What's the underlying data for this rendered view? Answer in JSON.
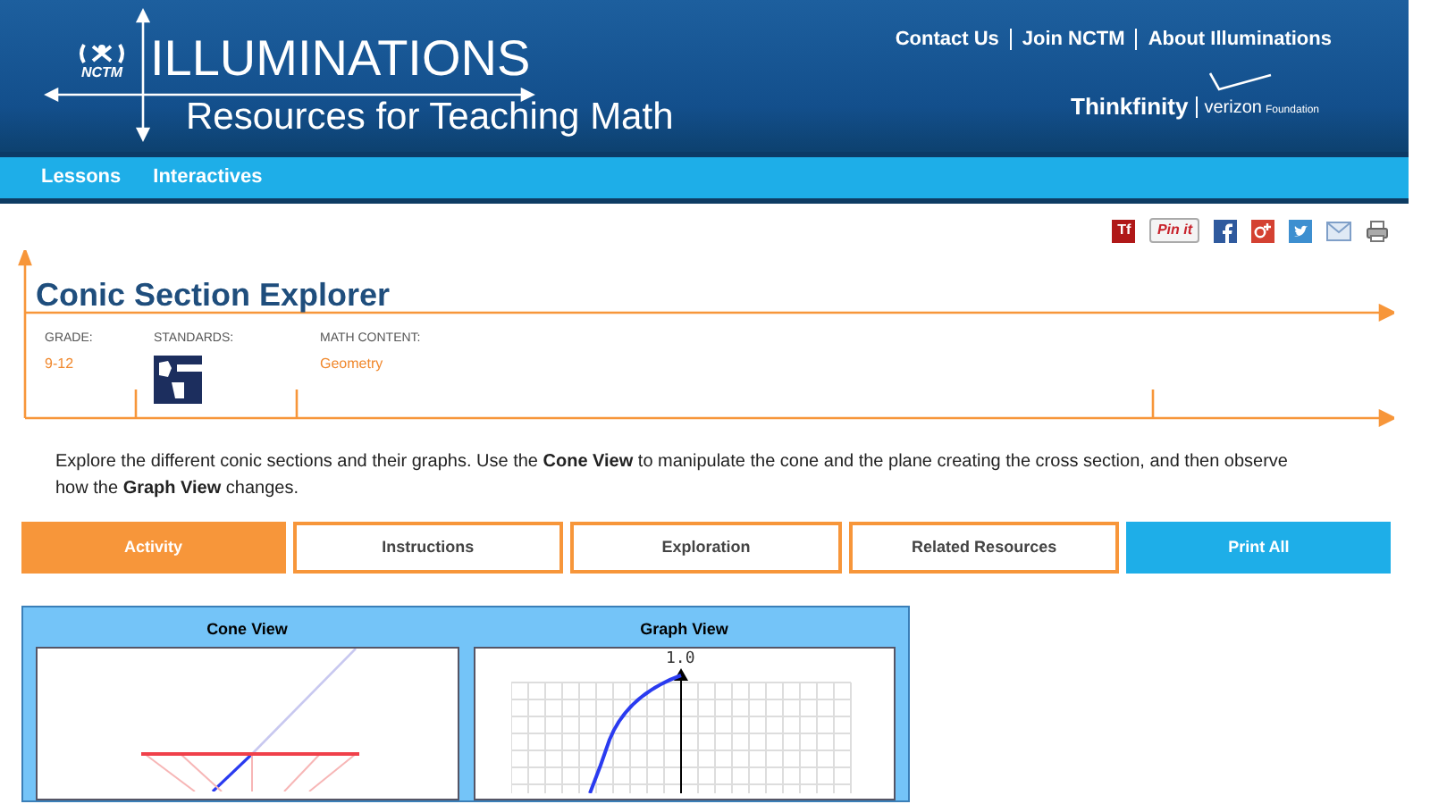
{
  "header": {
    "logo": {
      "badge": "NCTM",
      "name": "ILLUMINATIONS",
      "tagline": "Resources for Teaching Math"
    },
    "links": [
      "Contact Us",
      "Join NCTM",
      "About Illuminations"
    ],
    "sponsor": {
      "name": "Thinkfinity",
      "partner": "verizon",
      "partner_suffix": "Foundation"
    }
  },
  "nav": [
    {
      "label": "Lessons"
    },
    {
      "label": "Interactives"
    }
  ],
  "share": {
    "badge": "Tf",
    "pin_label": "Pin it"
  },
  "title": "Conic Section Explorer",
  "meta": [
    {
      "kind": "text",
      "label": "GRADE:",
      "value": "9-12"
    },
    {
      "kind": "icon",
      "label": "STANDARDS:"
    },
    {
      "kind": "text",
      "label": "MATH CONTENT:",
      "value": "Geometry"
    }
  ],
  "description": "Explore the different conic sections and their graphs. Use the **Cone View** to manipulate the cone and the plane creating the cross section, and then observe how the **Graph View** changes.",
  "tabs": [
    {
      "kind": "tab",
      "label": "Activity",
      "selected": true
    },
    {
      "kind": "tab",
      "label": "Instructions",
      "selected": false
    },
    {
      "kind": "tab",
      "label": "Exploration",
      "selected": false
    },
    {
      "kind": "tab",
      "label": "Related Resources",
      "selected": false
    },
    {
      "kind": "action",
      "label": "Print All"
    }
  ],
  "applet": {
    "panels": [
      {
        "kind": "cone",
        "title": "Cone View"
      },
      {
        "kind": "graph",
        "title": "Graph View",
        "axis_label": "1.0"
      }
    ]
  }
}
